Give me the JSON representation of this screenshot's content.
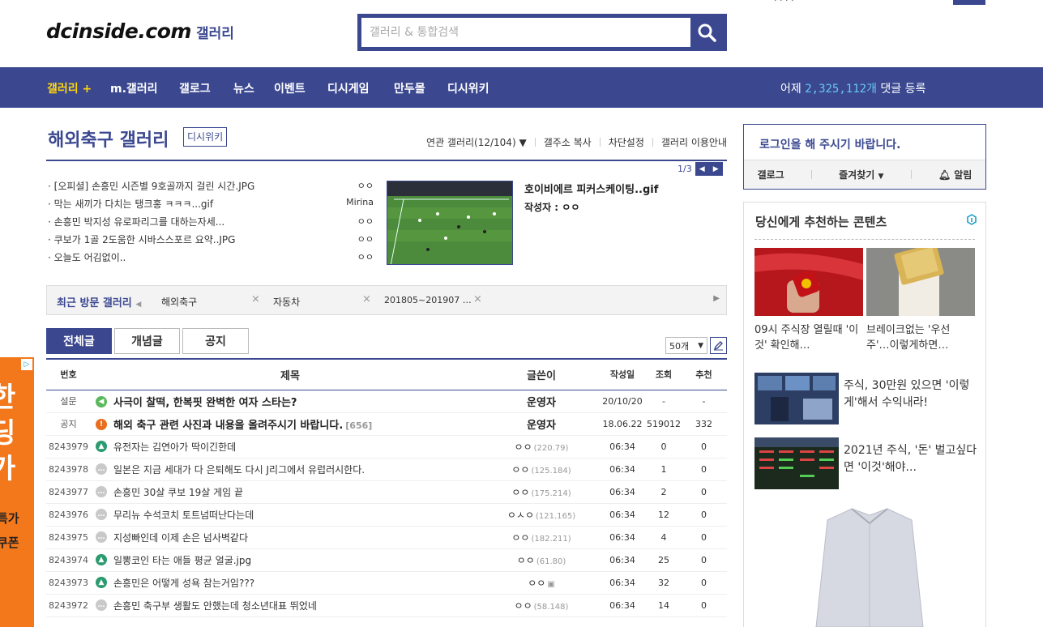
{
  "header": {
    "top_links": "·  ·  ·  ·",
    "logo": "dcinside.com",
    "logo_sub": "갤러리",
    "search_placeholder": "갤러리 & 통합검색"
  },
  "gnb": {
    "items": [
      "갤러리 +",
      "m.갤러리",
      "갤로그",
      "뉴스",
      "이벤트",
      "디시게임",
      "만두몰",
      "디시위키"
    ],
    "stat_prefix": "어제",
    "stat_num": "2,325,112개",
    "stat_suffix": "댓글 등록"
  },
  "gallery": {
    "title": "해외축구 갤러리",
    "wiki_badge": "디시위키",
    "menu": [
      "연관 갤러리(12/104)",
      "갤주소 복사",
      "차단설정",
      "갤러리 이용안내"
    ]
  },
  "issue": {
    "list": [
      {
        "title": "[오피셜] 손흥민 시즌별 9호골까지 걸린 시간.JPG",
        "writer": "ㅇㅇ"
      },
      {
        "title": "막는 새끼가 다치는 탱크홍 ㅋㅋㅋ...gif",
        "writer": "Mirina"
      },
      {
        "title": "손흥민 박지성 유로파리그를 대하는자세...",
        "writer": "ㅇㅇ"
      },
      {
        "title": "쿠보가 1골 2도움한 시바스스포르 요약..JPG",
        "writer": "ㅇㅇ"
      },
      {
        "title": "오늘도 어김없이..",
        "writer": "ㅇㅇ"
      }
    ],
    "feature_title": "호이비에르 피커스케이팅..gif",
    "feature_writer": "작성자 : ㅇㅇ",
    "pager": "1/3"
  },
  "recent": {
    "label": "최근 방문 갤러리",
    "items": [
      "해외축구",
      "자동차",
      "201805~201907 …"
    ]
  },
  "tabs": [
    "전체글",
    "개념글",
    "공지"
  ],
  "list_size": "50개",
  "board": {
    "headers": [
      "번호",
      "제목",
      "글쓴이",
      "작성일",
      "조회",
      "추천"
    ],
    "notices": [
      {
        "num": "설문",
        "icon": "survey",
        "title": "사극이 찰떡, 한복핏 완벽한 여자 스타는?",
        "reply": "",
        "writer": "운영자",
        "date": "20/10/20",
        "views": "-",
        "rec": "-"
      },
      {
        "num": "공지",
        "icon": "notice",
        "title": "해외 축구 관련 사진과 내용을 올려주시기 바랍니다.",
        "reply": "[656]",
        "writer": "운영자",
        "date": "18.06.22",
        "views": "519012",
        "rec": "332"
      }
    ],
    "rows": [
      {
        "num": "8243979",
        "icon": "img",
        "title": "유전자는 김연아가 딱이긴한데",
        "writer": "ㅇㅇ",
        "ip": "(220.79)",
        "date": "06:34",
        "views": "0",
        "rec": "0"
      },
      {
        "num": "8243978",
        "icon": "txt",
        "title": "일본은 지금 세대가 다 은퇴해도 다시 J리그에서 유럽러시한다.",
        "writer": "ㅇㅇ",
        "ip": "(125.184)",
        "date": "06:34",
        "views": "1",
        "rec": "0"
      },
      {
        "num": "8243977",
        "icon": "txt",
        "title": "손흥민 30살 쿠보 19살 게임 끝",
        "writer": "ㅇㅇ",
        "ip": "(175.214)",
        "date": "06:34",
        "views": "2",
        "rec": "0"
      },
      {
        "num": "8243976",
        "icon": "txt",
        "title": "무리뉴 수석코치 토트넘떠난다는데",
        "writer": "ㅇㅅㅇ",
        "ip": "(121.165)",
        "date": "06:34",
        "views": "12",
        "rec": "0"
      },
      {
        "num": "8243975",
        "icon": "txt",
        "title": "지성빠인데 이제 손은 넘사벽같다",
        "writer": "ㅇㅇ",
        "ip": "(182.211)",
        "date": "06:34",
        "views": "4",
        "rec": "0"
      },
      {
        "num": "8243974",
        "icon": "img",
        "title": "일뽕코인 타는 애들 평균 얼굴.jpg",
        "writer": "ㅇㅇ",
        "ip": "(61.80)",
        "date": "06:34",
        "views": "25",
        "rec": "0"
      },
      {
        "num": "8243973",
        "icon": "img",
        "title": "손흥민은 어떻게 성욕 참는거임???",
        "writer": "ㅇㅇ",
        "ip": "",
        "date": "06:34",
        "views": "32",
        "rec": "0"
      },
      {
        "num": "8243972",
        "icon": "txt",
        "title": "손흥민 축구부 생활도 안했는데 청소년대표 뛰었네",
        "writer": "ㅇㅇ",
        "ip": "(58.148)",
        "date": "06:34",
        "views": "14",
        "rec": "0"
      }
    ]
  },
  "login": {
    "message": "로그인을 해 주시기 바랍니다.",
    "links": [
      "갤로그",
      "즐겨찾기",
      "알림"
    ]
  },
  "recommend": {
    "title": "당신에게 추천하는 콘텐츠",
    "cards": [
      {
        "text": "09시 주식장 열릴때 '이것' 확인해…"
      },
      {
        "text": "브레이크없는 '우선주'…이렇게하면…"
      },
      {
        "text": "주식, 30만원 있으면 '이렇게'해서 수익내라!"
      },
      {
        "text": "2021년 주식, '돈' 벌고싶다면 '이것'해야..."
      }
    ]
  },
  "side_ad": {
    "big": "한\n딩\n가",
    "small": "특가\n쿠폰"
  },
  "colors": {
    "brand": "#3b4890",
    "accent_yellow": "#ffd50b",
    "accent_cyan": "#68c6f0",
    "ad_orange": "#f3781c"
  }
}
